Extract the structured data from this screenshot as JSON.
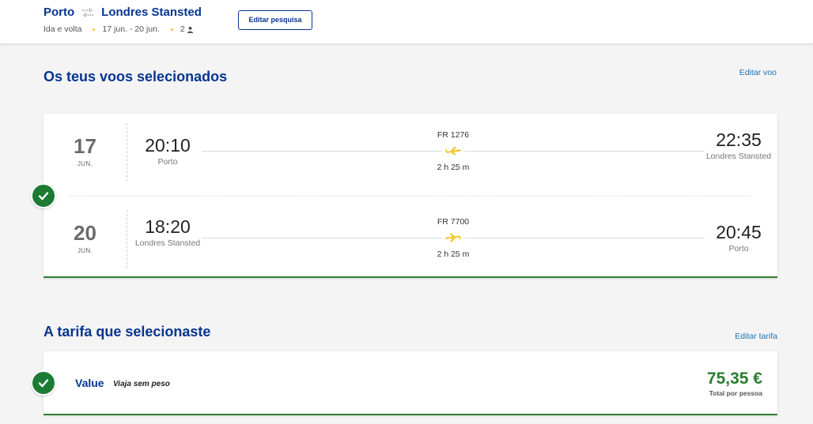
{
  "colors": {
    "brand_blue": "#073590",
    "link_blue": "#1973ba",
    "success_green": "#1c7a33",
    "price_green": "#2e7d32",
    "accent_yellow": "#f1c933"
  },
  "header": {
    "origin": "Porto",
    "destination": "Londres Stansted",
    "trip_type": "Ida e volta",
    "dates": "17 jun. - 20 jun.",
    "passengers": "2",
    "route_icon": "return-arrows-icon",
    "passenger_icon": "person-icon",
    "edit_search_label": "Editar pesquisa"
  },
  "flights_section": {
    "title": "Os teus voos selecionados",
    "edit_label": "Editar voo",
    "status_icon": "check-circle-icon",
    "flights": [
      {
        "day": "17",
        "month": "JUN.",
        "departure_time": "20:10",
        "departure_airport": "Porto",
        "flight_number": "FR 1276",
        "duration": "2 h 25 m",
        "arrival_time": "22:35",
        "arrival_airport": "Londres Stansted",
        "plane_icon": "plane-outbound-icon"
      },
      {
        "day": "20",
        "month": "JUN.",
        "departure_time": "18:20",
        "departure_airport": "Londres Stansted",
        "flight_number": "FR 7700",
        "duration": "2 h 25 m",
        "arrival_time": "20:45",
        "arrival_airport": "Porto",
        "plane_icon": "plane-inbound-icon"
      }
    ]
  },
  "fare_section": {
    "title": "A tarifa que selecionaste",
    "edit_label": "Editar tarifa",
    "status_icon": "check-circle-icon",
    "fare_name": "Value",
    "fare_tagline": "Viaja sem peso",
    "price": "75,35 €",
    "price_note": "Total por pessoa"
  }
}
